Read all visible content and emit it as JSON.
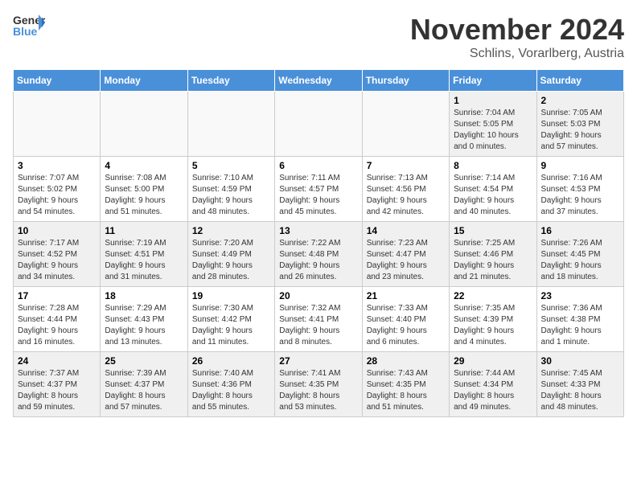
{
  "logo": {
    "general": "General",
    "blue": "Blue"
  },
  "title": "November 2024",
  "subtitle": "Schlins, Vorarlberg, Austria",
  "headers": [
    "Sunday",
    "Monday",
    "Tuesday",
    "Wednesday",
    "Thursday",
    "Friday",
    "Saturday"
  ],
  "weeks": [
    [
      {
        "day": "",
        "detail": ""
      },
      {
        "day": "",
        "detail": ""
      },
      {
        "day": "",
        "detail": ""
      },
      {
        "day": "",
        "detail": ""
      },
      {
        "day": "",
        "detail": ""
      },
      {
        "day": "1",
        "detail": "Sunrise: 7:04 AM\nSunset: 5:05 PM\nDaylight: 10 hours\nand 0 minutes."
      },
      {
        "day": "2",
        "detail": "Sunrise: 7:05 AM\nSunset: 5:03 PM\nDaylight: 9 hours\nand 57 minutes."
      }
    ],
    [
      {
        "day": "3",
        "detail": "Sunrise: 7:07 AM\nSunset: 5:02 PM\nDaylight: 9 hours\nand 54 minutes."
      },
      {
        "day": "4",
        "detail": "Sunrise: 7:08 AM\nSunset: 5:00 PM\nDaylight: 9 hours\nand 51 minutes."
      },
      {
        "day": "5",
        "detail": "Sunrise: 7:10 AM\nSunset: 4:59 PM\nDaylight: 9 hours\nand 48 minutes."
      },
      {
        "day": "6",
        "detail": "Sunrise: 7:11 AM\nSunset: 4:57 PM\nDaylight: 9 hours\nand 45 minutes."
      },
      {
        "day": "7",
        "detail": "Sunrise: 7:13 AM\nSunset: 4:56 PM\nDaylight: 9 hours\nand 42 minutes."
      },
      {
        "day": "8",
        "detail": "Sunrise: 7:14 AM\nSunset: 4:54 PM\nDaylight: 9 hours\nand 40 minutes."
      },
      {
        "day": "9",
        "detail": "Sunrise: 7:16 AM\nSunset: 4:53 PM\nDaylight: 9 hours\nand 37 minutes."
      }
    ],
    [
      {
        "day": "10",
        "detail": "Sunrise: 7:17 AM\nSunset: 4:52 PM\nDaylight: 9 hours\nand 34 minutes."
      },
      {
        "day": "11",
        "detail": "Sunrise: 7:19 AM\nSunset: 4:51 PM\nDaylight: 9 hours\nand 31 minutes."
      },
      {
        "day": "12",
        "detail": "Sunrise: 7:20 AM\nSunset: 4:49 PM\nDaylight: 9 hours\nand 28 minutes."
      },
      {
        "day": "13",
        "detail": "Sunrise: 7:22 AM\nSunset: 4:48 PM\nDaylight: 9 hours\nand 26 minutes."
      },
      {
        "day": "14",
        "detail": "Sunrise: 7:23 AM\nSunset: 4:47 PM\nDaylight: 9 hours\nand 23 minutes."
      },
      {
        "day": "15",
        "detail": "Sunrise: 7:25 AM\nSunset: 4:46 PM\nDaylight: 9 hours\nand 21 minutes."
      },
      {
        "day": "16",
        "detail": "Sunrise: 7:26 AM\nSunset: 4:45 PM\nDaylight: 9 hours\nand 18 minutes."
      }
    ],
    [
      {
        "day": "17",
        "detail": "Sunrise: 7:28 AM\nSunset: 4:44 PM\nDaylight: 9 hours\nand 16 minutes."
      },
      {
        "day": "18",
        "detail": "Sunrise: 7:29 AM\nSunset: 4:43 PM\nDaylight: 9 hours\nand 13 minutes."
      },
      {
        "day": "19",
        "detail": "Sunrise: 7:30 AM\nSunset: 4:42 PM\nDaylight: 9 hours\nand 11 minutes."
      },
      {
        "day": "20",
        "detail": "Sunrise: 7:32 AM\nSunset: 4:41 PM\nDaylight: 9 hours\nand 8 minutes."
      },
      {
        "day": "21",
        "detail": "Sunrise: 7:33 AM\nSunset: 4:40 PM\nDaylight: 9 hours\nand 6 minutes."
      },
      {
        "day": "22",
        "detail": "Sunrise: 7:35 AM\nSunset: 4:39 PM\nDaylight: 9 hours\nand 4 minutes."
      },
      {
        "day": "23",
        "detail": "Sunrise: 7:36 AM\nSunset: 4:38 PM\nDaylight: 9 hours\nand 1 minute."
      }
    ],
    [
      {
        "day": "24",
        "detail": "Sunrise: 7:37 AM\nSunset: 4:37 PM\nDaylight: 8 hours\nand 59 minutes."
      },
      {
        "day": "25",
        "detail": "Sunrise: 7:39 AM\nSunset: 4:37 PM\nDaylight: 8 hours\nand 57 minutes."
      },
      {
        "day": "26",
        "detail": "Sunrise: 7:40 AM\nSunset: 4:36 PM\nDaylight: 8 hours\nand 55 minutes."
      },
      {
        "day": "27",
        "detail": "Sunrise: 7:41 AM\nSunset: 4:35 PM\nDaylight: 8 hours\nand 53 minutes."
      },
      {
        "day": "28",
        "detail": "Sunrise: 7:43 AM\nSunset: 4:35 PM\nDaylight: 8 hours\nand 51 minutes."
      },
      {
        "day": "29",
        "detail": "Sunrise: 7:44 AM\nSunset: 4:34 PM\nDaylight: 8 hours\nand 49 minutes."
      },
      {
        "day": "30",
        "detail": "Sunrise: 7:45 AM\nSunset: 4:33 PM\nDaylight: 8 hours\nand 48 minutes."
      }
    ]
  ]
}
